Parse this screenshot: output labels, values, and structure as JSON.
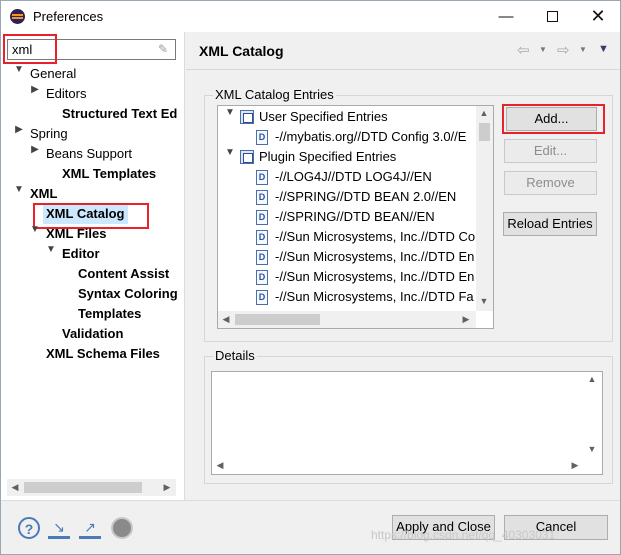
{
  "window": {
    "title": "Preferences",
    "minimize": "—",
    "close": "✕"
  },
  "filter": {
    "value": "xml",
    "clear_icon": "eraser-icon"
  },
  "tree": [
    {
      "label": "General",
      "bold": false
    },
    {
      "label": "Editors",
      "bold": false
    },
    {
      "label": "Structured Text Ed",
      "bold": true
    },
    {
      "label": "Spring",
      "bold": false
    },
    {
      "label": "Beans Support",
      "bold": false
    },
    {
      "label": "XML Templates",
      "bold": true
    },
    {
      "label": "XML",
      "bold": true
    },
    {
      "label": "XML Catalog",
      "bold": true,
      "selected": true
    },
    {
      "label": "XML Files",
      "bold": true
    },
    {
      "label": "Editor",
      "bold": true
    },
    {
      "label": "Content Assist",
      "bold": true
    },
    {
      "label": "Syntax Coloring",
      "bold": true
    },
    {
      "label": "Templates",
      "bold": true
    },
    {
      "label": "Validation",
      "bold": true
    },
    {
      "label": "XML Schema Files",
      "bold": true
    }
  ],
  "page": {
    "title": "XML Catalog"
  },
  "catalog": {
    "group_label": "XML Catalog Entries",
    "entries": [
      {
        "label": "User Specified Entries",
        "kind": "group"
      },
      {
        "label": "-//mybatis.org//DTD Config 3.0//E",
        "kind": "doc"
      },
      {
        "label": "Plugin Specified Entries",
        "kind": "group"
      },
      {
        "label": "-//LOG4J//DTD LOG4J//EN",
        "kind": "doc"
      },
      {
        "label": "-//SPRING//DTD BEAN 2.0//EN",
        "kind": "doc"
      },
      {
        "label": "-//SPRING//DTD BEAN//EN",
        "kind": "doc"
      },
      {
        "label": "-//Sun Microsystems, Inc.//DTD Co",
        "kind": "doc"
      },
      {
        "label": "-//Sun Microsystems, Inc.//DTD En",
        "kind": "doc"
      },
      {
        "label": "-//Sun Microsystems, Inc.//DTD En",
        "kind": "doc"
      },
      {
        "label": "-//Sun Microsystems, Inc.//DTD Fa",
        "kind": "doc"
      }
    ],
    "buttons": {
      "add": "Add...",
      "edit": "Edit...",
      "remove": "Remove",
      "reload": "Reload Entries"
    }
  },
  "details": {
    "label": "Details"
  },
  "footer": {
    "apply_close": "Apply and Close",
    "cancel": "Cancel",
    "watermark": "https://blog.csdn.net/qq_40303031"
  },
  "colors": {
    "highlight": "#e8222b",
    "selection": "#cce8ff"
  }
}
